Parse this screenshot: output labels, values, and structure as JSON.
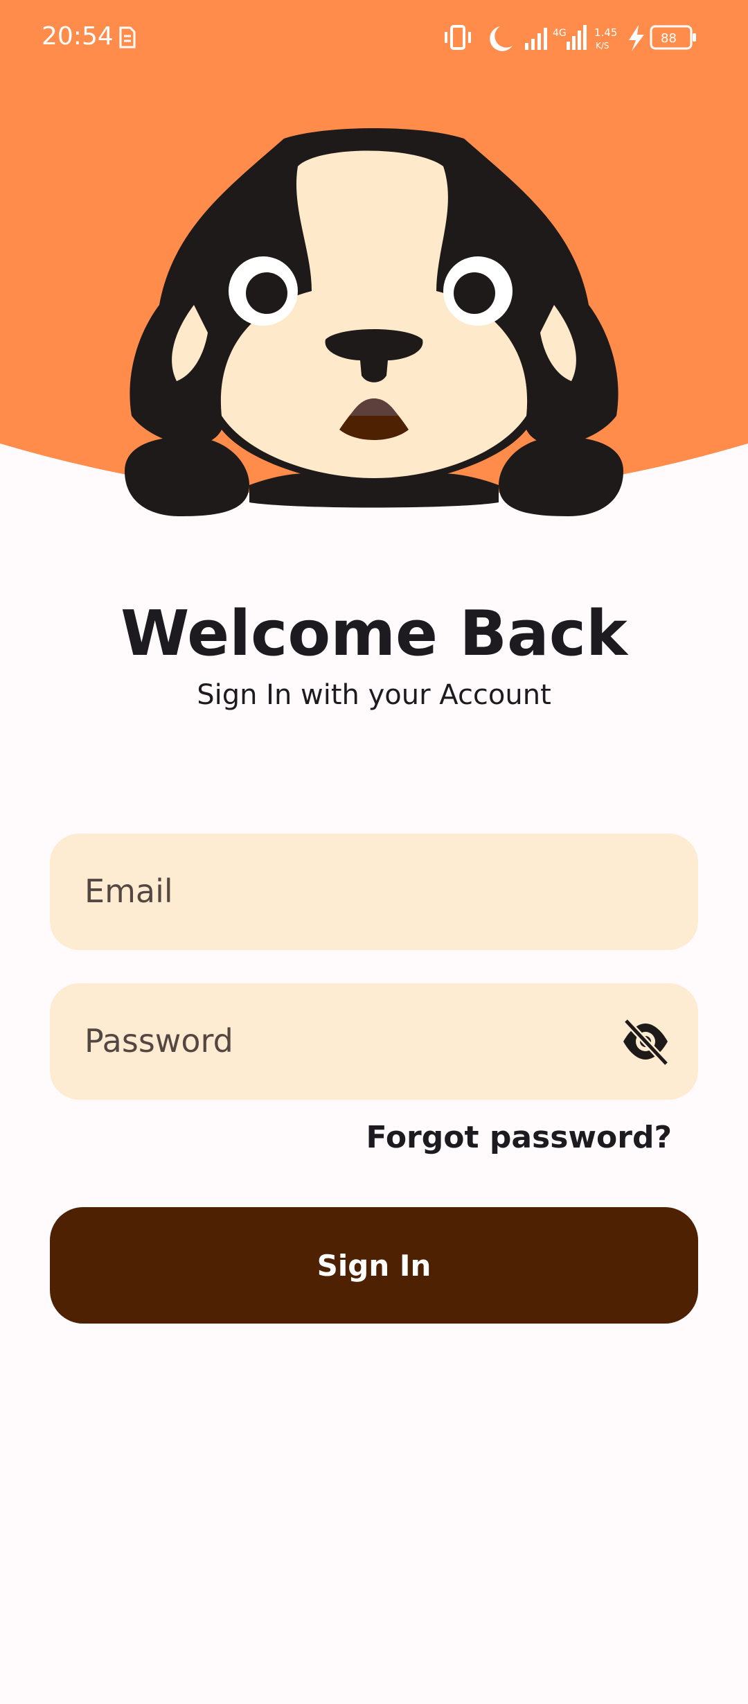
{
  "status_bar": {
    "time": "20:54",
    "network_type": "4G",
    "speed_value": "1.45",
    "speed_unit": "K/S",
    "battery_level": "88"
  },
  "header": {
    "background_color": "#ff8c4a",
    "illustration": "bulldog-mascot"
  },
  "main": {
    "title": "Welcome Back",
    "subtitle": "Sign In with your Account"
  },
  "form": {
    "email_placeholder": "Email",
    "password_placeholder": "Password",
    "password_visibility_icon": "eye-off-icon",
    "forgot_password_label": "Forgot password?",
    "sign_in_label": "Sign In"
  },
  "colors": {
    "accent": "#ff8c4a",
    "field_background": "#feecd2",
    "primary_button": "#4d2102",
    "page_background": "#fffbfd"
  }
}
